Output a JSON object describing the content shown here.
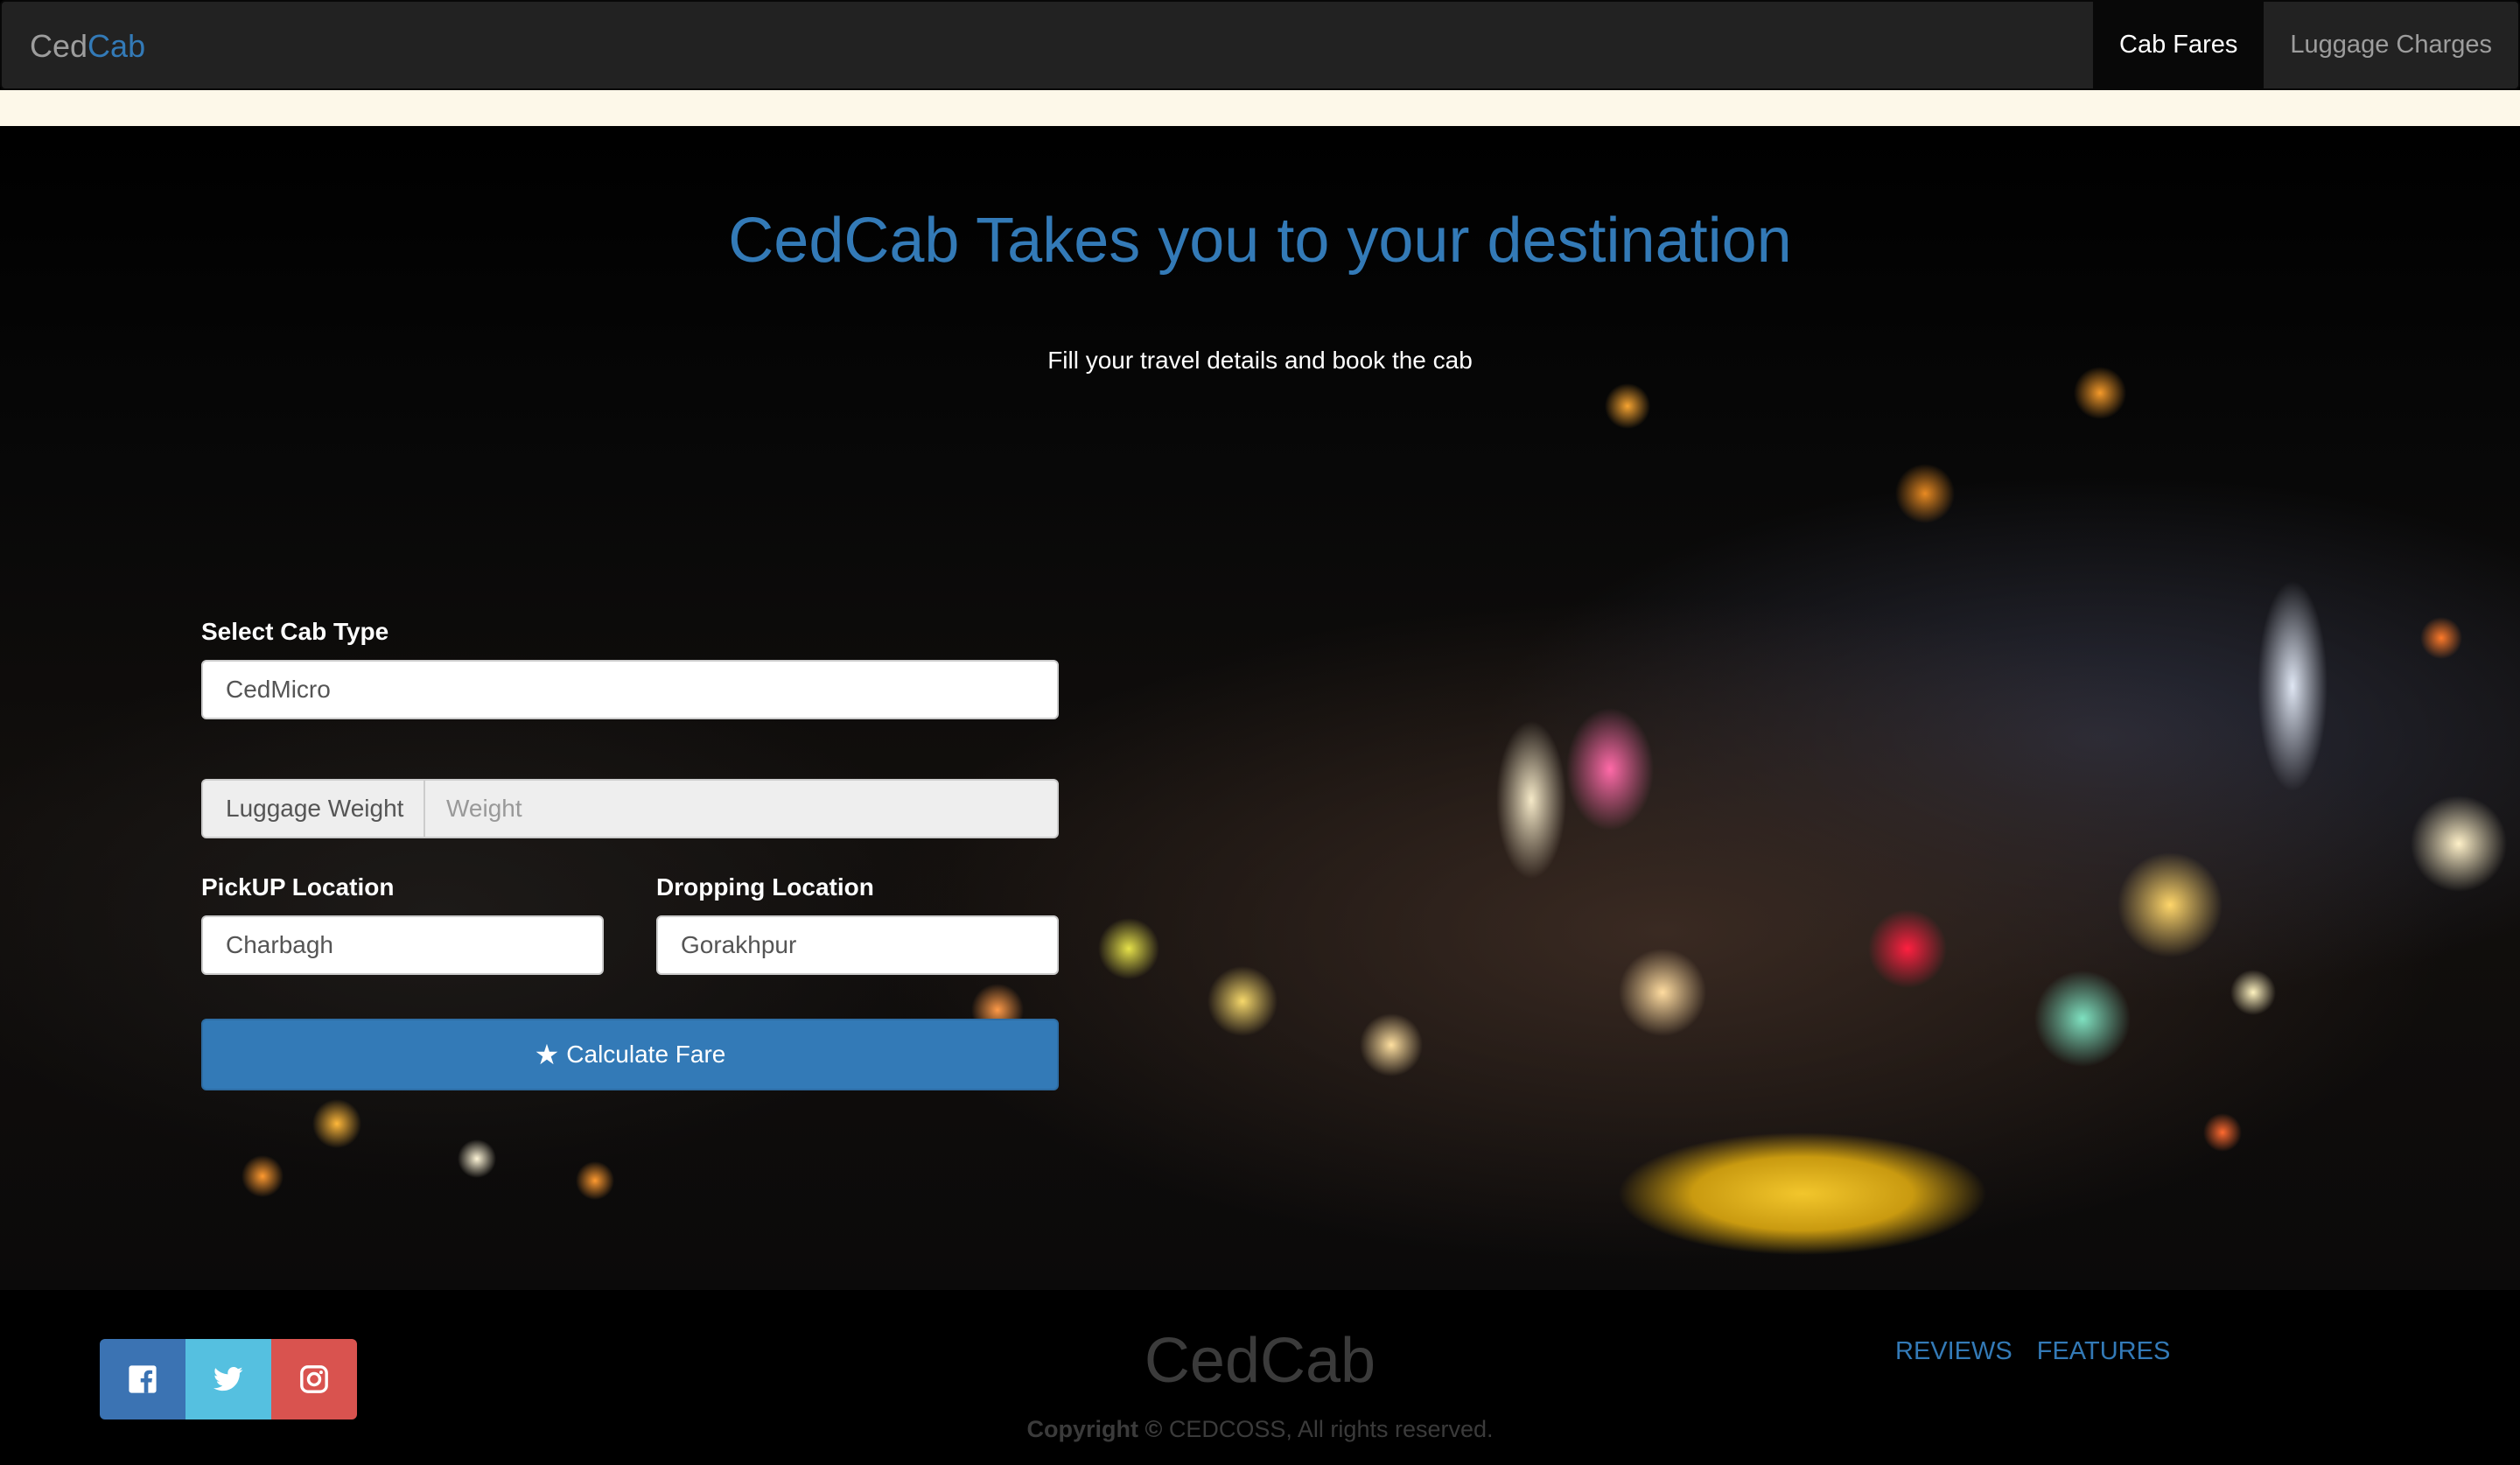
{
  "navbar": {
    "brand_part1": "Ced",
    "brand_part2": "Cab",
    "links": [
      "Cab Fares",
      "Luggage Charges"
    ],
    "active": "Cab Fares"
  },
  "hero": {
    "title": "CedCab Takes you to your destination",
    "subtitle": "Fill your travel details and book the cab"
  },
  "form": {
    "cab_type_label": "Select Cab Type",
    "cab_type_value": "CedMicro",
    "luggage_addon": "Luggage Weight",
    "luggage_placeholder": "Weight",
    "pickup_label": "PickUP Location",
    "pickup_value": "Charbagh",
    "drop_label": "Dropping Location",
    "drop_value": "Gorakhpur",
    "submit_label": "Calculate Fare"
  },
  "footer": {
    "brand": "CedCab",
    "copyright_bold": "Copyright ©",
    "copyright_rest": "CEDCOSS, All rights reserved.",
    "links": [
      "REVIEWS",
      "FEATURES"
    ],
    "social": [
      "facebook-icon",
      "twitter-icon",
      "instagram-icon"
    ]
  },
  "colors": {
    "accent": "#337ab7",
    "navbar_bg": "#222222",
    "cream_bar": "#fdf8e9",
    "facebook": "#3b73b3",
    "twitter": "#55c0e0",
    "instagram": "#d9534f"
  }
}
